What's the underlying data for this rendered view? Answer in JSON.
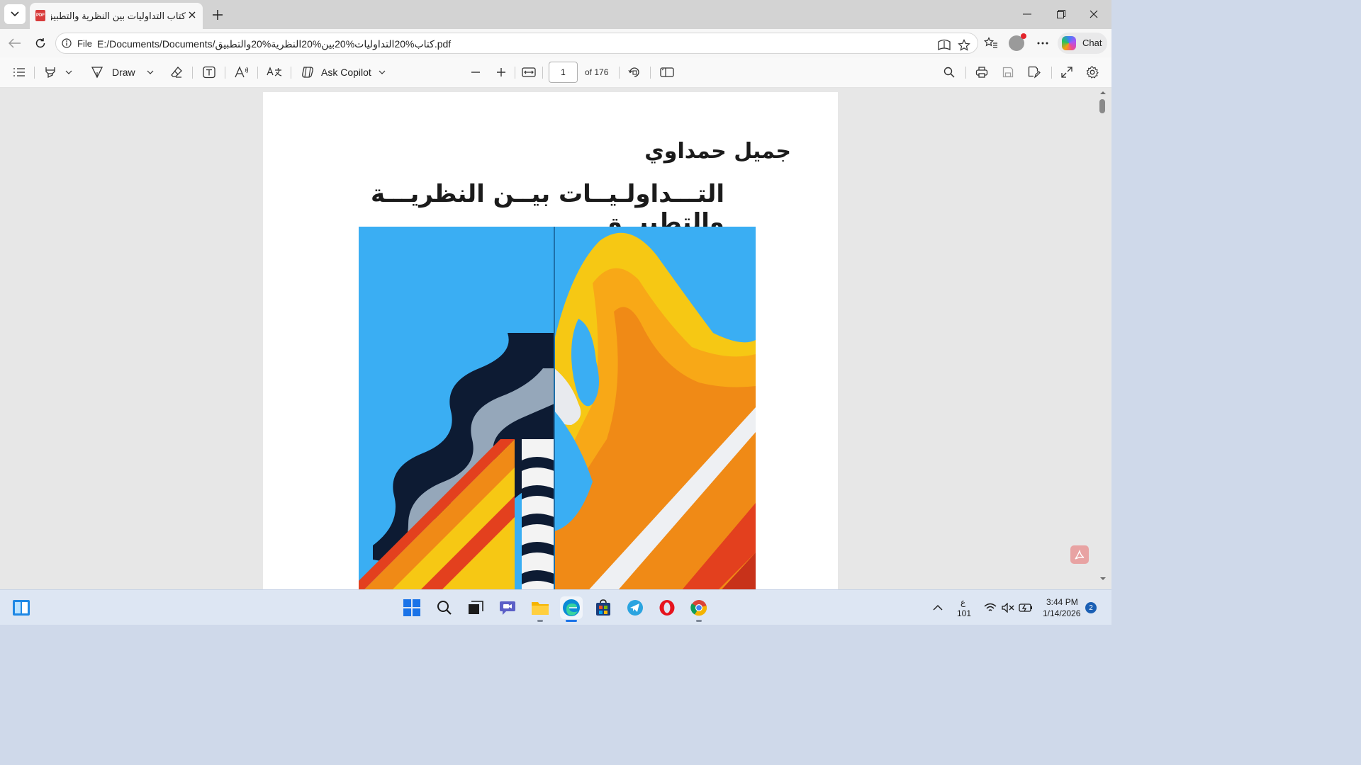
{
  "tab": {
    "title": "كتاب التداوليات بين النظرية والتطبيق",
    "favicon_label": "PDF"
  },
  "address_bar": {
    "scheme": "File",
    "url": "E:/Documents/Documents/كتاب%20التداوليات%20بين%20النظرية%20والتطبيق.pdf"
  },
  "chat_button": {
    "label": "Chat"
  },
  "pdf_toolbar": {
    "draw_label": "Draw",
    "ask_copilot_label": "Ask Copilot",
    "current_page": "1",
    "page_count_label": "of 176"
  },
  "document": {
    "author": "جميل حمداوي",
    "title": "التـــداولـيــات بيــن النظريـــة والتطبيــق"
  },
  "taskbar": {
    "language_indicator": "ع",
    "language_sub": "101",
    "time": "3:44 PM",
    "date": "1/14/2026",
    "notification_count": "2"
  },
  "icons": {
    "tab_list": "chevron-down-icon",
    "tab_close": "close-icon",
    "new_tab": "plus-icon",
    "minimize": "minimize-icon",
    "maximize": "restore-icon",
    "close": "close-icon",
    "back": "back-arrow-icon",
    "refresh": "refresh-icon",
    "info": "info-icon",
    "search": "search-icon",
    "print": "print-icon",
    "save": "save-icon",
    "save_as": "save-as-icon",
    "fullscreen": "fullscreen-icon",
    "settings": "gear-icon"
  },
  "colors": {
    "tab_strip": "#d3d3d3",
    "toolbar": "#f9f9f9",
    "viewer_bg": "#e7e7e7",
    "taskbar": "#dde6f3",
    "accent": "#1a73e8",
    "cover_blue": "#3aaef3",
    "cover_yellow": "#f6c814",
    "cover_orange": "#f08a16",
    "cover_red": "#e3401e"
  }
}
